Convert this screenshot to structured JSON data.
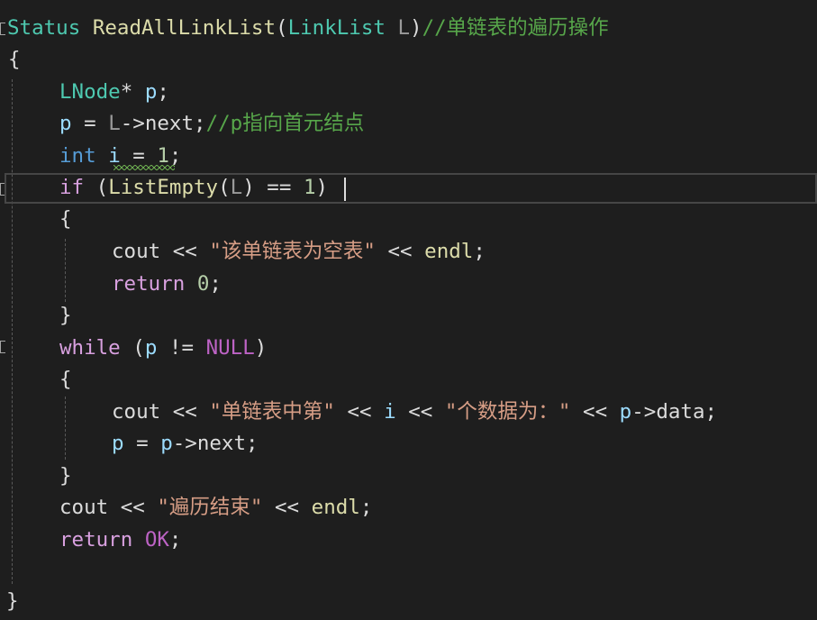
{
  "code": {
    "l1": {
      "return_type": "Status",
      "func_name": "ReadAllLinkList",
      "open_paren": "(",
      "param_type": "LinkList",
      "param_name": "L",
      "close_paren": ")",
      "comment": "//单链表的遍历操作"
    },
    "l2": {
      "brace": "{"
    },
    "l3": {
      "type": "LNode",
      "star": "*",
      "var": "p",
      "semi": ";"
    },
    "l4": {
      "var": "p",
      "op": " = ",
      "param": "L",
      "arrow": "->",
      "member": "next",
      "semi": ";",
      "comment": "//p指向首元结点"
    },
    "l5": {
      "kw": "int",
      "var": "i",
      "op": " = ",
      "num": "1",
      "semi": ";"
    },
    "l6": {
      "kw": "if",
      "open": " (",
      "fn": "ListEmpty",
      "p1": "(",
      "param": "L",
      "p2": ")",
      "op": " == ",
      "num": "1",
      "close": ")"
    },
    "l7": {
      "brace": "{"
    },
    "l8": {
      "cout": "cout",
      "op1": " << ",
      "str": "\"该单链表为空表\"",
      "op2": " << ",
      "endl": "endl",
      "semi": ";"
    },
    "l9": {
      "kw": "return",
      "num": "0",
      "semi": ";"
    },
    "l10": {
      "brace": "}"
    },
    "l11": {
      "kw": "while",
      "open": " (",
      "var": "p",
      "op": " != ",
      "macro": "NULL",
      "close": ")"
    },
    "l12": {
      "brace": "{"
    },
    "l13": {
      "cout": "cout",
      "op1": " << ",
      "str1": "\"单链表中第\"",
      "op2": " << ",
      "var": "i",
      "op3": " << ",
      "str2": "\"个数据为：\"",
      "op4": " << ",
      "var2": "p",
      "arrow": "->",
      "member": "data",
      "semi": ";"
    },
    "l14": {
      "var": "p",
      "op": " = ",
      "var2": "p",
      "arrow": "->",
      "member": "next",
      "semi": ";"
    },
    "l15": {
      "brace": "}"
    },
    "l16": {
      "cout": "cout",
      "op1": " << ",
      "str": "\"遍历结束\"",
      "op2": " << ",
      "endl": "endl",
      "semi": ";"
    },
    "l17": {
      "kw": "return",
      "macro": "OK",
      "semi": ";"
    },
    "l19": {
      "brace": "}"
    }
  },
  "colors": {
    "background": "#1e1e1e",
    "keyword": "#569cd6",
    "control": "#d8a0df",
    "type": "#4ec9b0",
    "function": "#dcdcaa",
    "variable": "#9cdcfe",
    "string": "#d69d85",
    "comment": "#57a64a",
    "number": "#b5cea8",
    "macro": "#bd63c5"
  }
}
